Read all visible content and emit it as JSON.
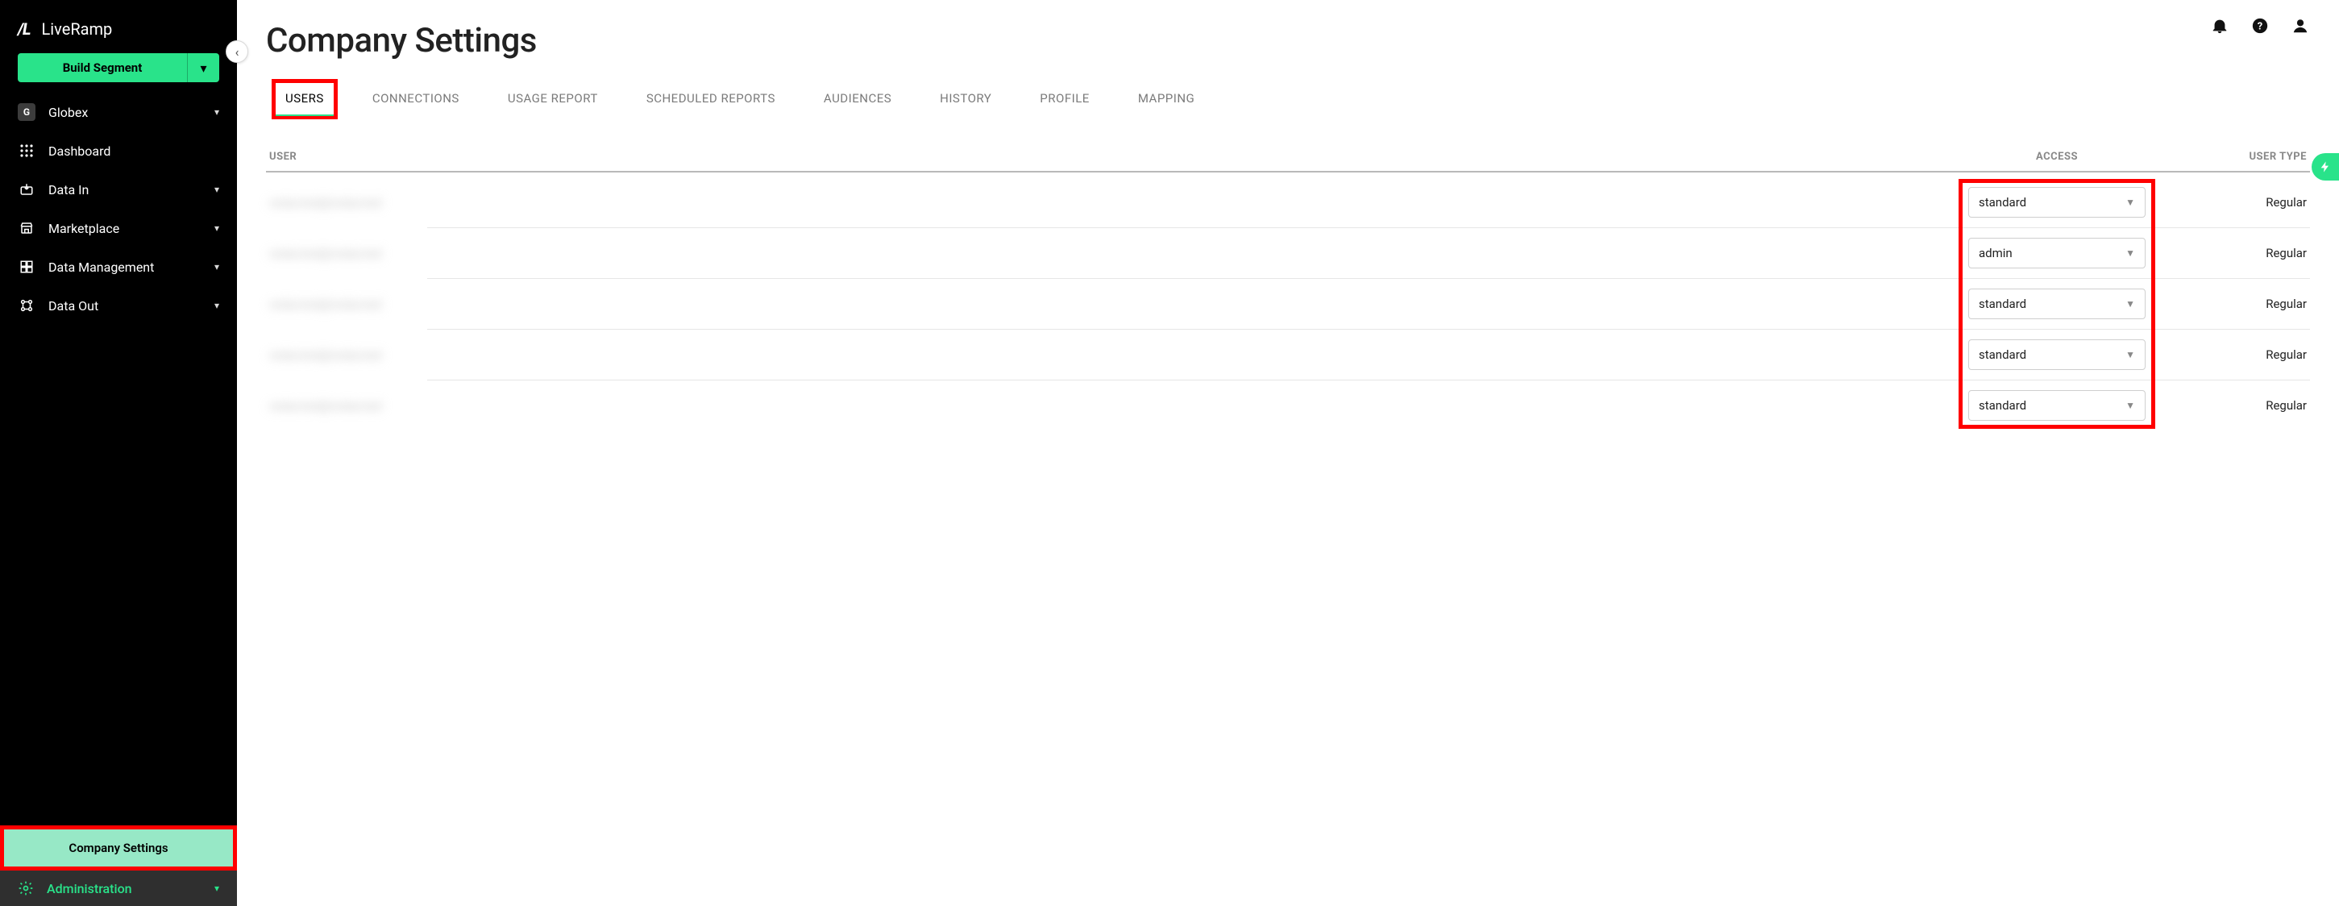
{
  "brand": {
    "logo": "/L",
    "name": "LiveRamp"
  },
  "build_segment": {
    "label": "Build Segment"
  },
  "org": {
    "initial": "G",
    "name": "Globex"
  },
  "sidebar": {
    "items": [
      {
        "key": "dashboard",
        "label": "Dashboard",
        "expandable": false
      },
      {
        "key": "data-in",
        "label": "Data In",
        "expandable": true
      },
      {
        "key": "marketplace",
        "label": "Marketplace",
        "expandable": true
      },
      {
        "key": "data-management",
        "label": "Data Management",
        "expandable": true
      },
      {
        "key": "data-out",
        "label": "Data Out",
        "expandable": true
      }
    ],
    "company_settings": "Company Settings",
    "administration": "Administration"
  },
  "page": {
    "title": "Company Settings"
  },
  "tabs": [
    {
      "key": "users",
      "label": "USERS",
      "active": true,
      "highlighted": true
    },
    {
      "key": "connections",
      "label": "CONNECTIONS"
    },
    {
      "key": "usage-report",
      "label": "USAGE REPORT"
    },
    {
      "key": "scheduled-reports",
      "label": "SCHEDULED REPORTS"
    },
    {
      "key": "audiences",
      "label": "AUDIENCES"
    },
    {
      "key": "history",
      "label": "HISTORY"
    },
    {
      "key": "profile",
      "label": "PROFILE"
    },
    {
      "key": "mapping",
      "label": "MAPPING"
    }
  ],
  "table": {
    "headers": {
      "user": "USER",
      "access": "ACCESS",
      "user_type": "USER TYPE"
    },
    "rows": [
      {
        "user": "redacted@redacted",
        "access": "standard",
        "user_type": "Regular"
      },
      {
        "user": "redacted@redacted",
        "access": "admin",
        "user_type": "Regular"
      },
      {
        "user": "redacted@redacted",
        "access": "standard",
        "user_type": "Regular"
      },
      {
        "user": "redacted@redacted",
        "access": "standard",
        "user_type": "Regular"
      },
      {
        "user": "redacted@redacted",
        "access": "standard",
        "user_type": "Regular"
      }
    ]
  },
  "colors": {
    "accent": "#29e38a",
    "highlight": "#f00"
  }
}
